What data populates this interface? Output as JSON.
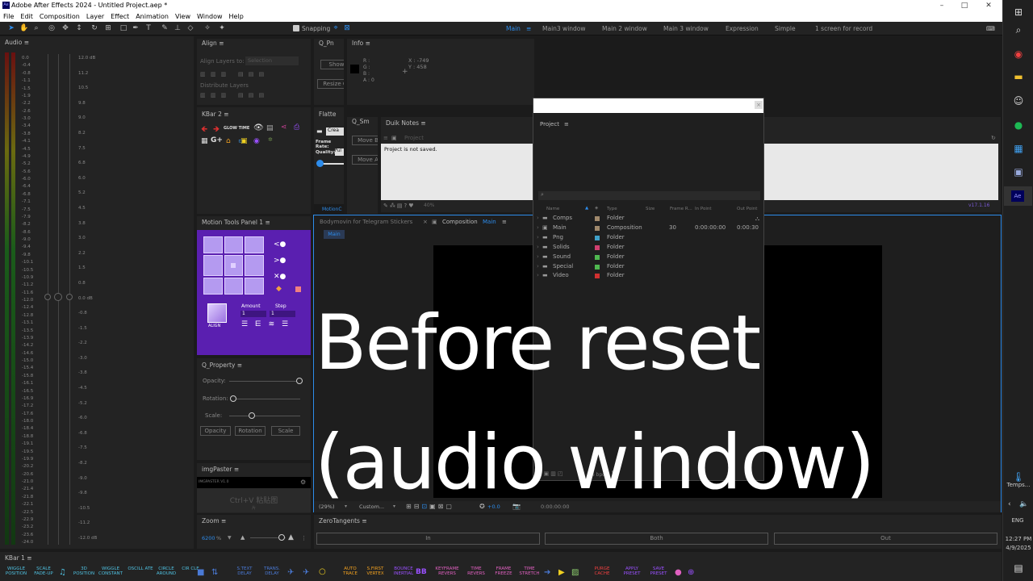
{
  "window": {
    "title": "Adobe After Effects 2024 - Untitled Project.aep *",
    "logo": "Ae",
    "controls": [
      "–",
      "□",
      "✕"
    ]
  },
  "menu": [
    "File",
    "Edit",
    "Composition",
    "Layer",
    "Effect",
    "Animation",
    "View",
    "Window",
    "Help"
  ],
  "toolbar": {
    "snapping_label": "Snapping",
    "workspaces": [
      "Main",
      "Main3 window",
      "Main 2 window",
      "Main 3 window",
      "Expression",
      "Simple",
      "1 screen for record"
    ]
  },
  "audio": {
    "title": "Audio",
    "left_scale": [
      "0.0",
      "-0.4",
      "-0.8",
      "-1.1",
      "-1.5",
      "-1.9",
      "-2.2",
      "-2.6",
      "-3.0",
      "-3.4",
      "-3.8",
      "-4.1",
      "-4.5",
      "-4.9",
      "-5.2",
      "-5.6",
      "-6.0",
      "-6.4",
      "-6.8",
      "-7.1",
      "-7.5",
      "-7.9",
      "-8.2",
      "-8.6",
      "-9.0",
      "-9.4",
      "-9.8",
      "-10.1",
      "-10.5",
      "-10.9",
      "-11.2",
      "-11.6",
      "-12.0",
      "-12.4",
      "-12.8",
      "-13.1",
      "-13.5",
      "-13.9",
      "-14.2",
      "-14.6",
      "-15.0",
      "-15.4",
      "-15.8",
      "-16.1",
      "-16.5",
      "-16.9",
      "-17.2",
      "-17.6",
      "-18.0",
      "-18.4",
      "-18.8",
      "-19.1",
      "-19.5",
      "-19.9",
      "-20.2",
      "-20.6",
      "-21.0",
      "-21.4",
      "-21.8",
      "-22.1",
      "-22.5",
      "-22.9",
      "-23.2",
      "-23.6",
      "-24.0"
    ],
    "right_scale": [
      "12.0 dB",
      "11.2",
      "10.5",
      "9.8",
      "9.0",
      "8.2",
      "7.5",
      "6.8",
      "6.0",
      "5.2",
      "4.5",
      "3.8",
      "3.0",
      "2.2",
      "1.5",
      "0.8",
      "0.0 dB",
      "-0.8",
      "-1.5",
      "-2.2",
      "-3.0",
      "-3.8",
      "-4.5",
      "-5.2",
      "-6.0",
      "-6.8",
      "-7.5",
      "-8.2",
      "-9.0",
      "-9.8",
      "-10.5",
      "-11.2",
      "-12.0 dB"
    ]
  },
  "align": {
    "title": "Align",
    "align_to_label": "Align Layers to:",
    "align_to_value": "Selection",
    "distribute_label": "Distribute Layers"
  },
  "q_pn": {
    "title": "Q_Pn",
    "show": "Show",
    "resize": "Resize C"
  },
  "info": {
    "title": "Info",
    "r": "R :",
    "g": "G :",
    "b": "B :",
    "a": "A : 0",
    "x": "X : -749",
    "y": "Y : 458"
  },
  "kbar2": {
    "title": "KBar 2",
    "glow": "GLOW TIME"
  },
  "flatte": {
    "title": "Flatte",
    "create": "Crea",
    "frame_rate": "Frame Rate:",
    "quality": "Quality:",
    "quality_val": "Ful",
    "footer": "MotionC"
  },
  "q_sm": {
    "title": "Q_Sm",
    "move_b": "Move B",
    "move_a": "Move A"
  },
  "duik": {
    "title": "Duik Notes",
    "project_label": "Project",
    "note": "Project is not saved.",
    "zoom": "40%",
    "version": "v17.1.16"
  },
  "project": {
    "title": "Project",
    "columns": {
      "name": "Name",
      "type": "Type",
      "size": "Size",
      "frame": "Frame R...",
      "in": "In Point",
      "out": "Out Point"
    },
    "rows": [
      {
        "name": "Comps",
        "type": "Folder",
        "color": "#a0896c",
        "fr": "",
        "in": "",
        "out": ""
      },
      {
        "name": "Main",
        "type": "Composition",
        "color": "#a0896c",
        "fr": "30",
        "in": "0:00:00:00",
        "out": "0:00:30"
      },
      {
        "name": "Png",
        "type": "Folder",
        "color": "#3fa0c8",
        "fr": "",
        "in": "",
        "out": ""
      },
      {
        "name": "Solids",
        "type": "Folder",
        "color": "#d04070",
        "fr": "",
        "in": "",
        "out": ""
      },
      {
        "name": "Sound",
        "type": "Folder",
        "color": "#4fb850",
        "fr": "",
        "in": "",
        "out": ""
      },
      {
        "name": "Special",
        "type": "Folder",
        "color": "#4fb850",
        "fr": "",
        "in": "",
        "out": ""
      },
      {
        "name": "Video",
        "type": "Folder",
        "color": "#d03030",
        "fr": "",
        "in": "",
        "out": ""
      }
    ],
    "bpc": "16 bpc"
  },
  "motion_tools": {
    "title": "Motion Tools Panel 1",
    "amount_label": "Amount",
    "step_label": "Step",
    "amount": "1",
    "step": "1",
    "align": "ALIGN"
  },
  "q_property": {
    "title": "Q_Property",
    "opacity": "Opacity:",
    "rotation": "Rotation:",
    "scale": "Scale:",
    "buttons": [
      "Opacity",
      "Rotation",
      "Scale"
    ]
  },
  "imgpaster": {
    "title": "imgPaster",
    "version": "IMGPASTER V1.0",
    "hint": "Ctrl+V 粘贴图",
    "hint2": "片"
  },
  "zoom": {
    "title": "Zoom",
    "value": "6200",
    "unit": "%"
  },
  "comp": {
    "tab_other": "Bodymovin for Telegram Stickers",
    "tab_label": "Composition",
    "tab_name": "Main",
    "crumb": "Main",
    "zoom_level": "(29%)",
    "res": "Custom...",
    "exposure": "+0.0",
    "timecode": "0:00:00:00"
  },
  "zero_tangents": {
    "title": "ZeroTangents",
    "in": "In",
    "both": "Both",
    "out": "Out"
  },
  "kbar1": {
    "title": "KBar 1",
    "items": [
      "WIGGLE POSITION",
      "SCALE FADE-UP",
      "3D POSITION",
      "WIGGLE CONSTANT",
      "OSCILL ATE",
      "CIRCLE AROUND",
      "CIR CLE",
      "S.TEXT DELAY",
      "TRANS. DELAY",
      "AUTO TRACE",
      "S.FIRST VERTEX",
      "BOUNCE INERTIAL",
      "KEYFRAME REVERS",
      "TIME REVERS",
      "FRAME FREEZE",
      "TIME STRETCH",
      "PURGE CACHE",
      "APPLY PRESET",
      "SAVE PRESET"
    ]
  },
  "overlay": {
    "line1": "Before reset",
    "line2": "(audio window)"
  },
  "os": {
    "temps": "Temps...",
    "lang": "ENG",
    "time": "12:27 PM",
    "date": "4/9/2025"
  },
  "colors": {
    "accent": "#2d8ceb",
    "bg": "#1b1b1b",
    "panel": "#232323",
    "motion_purple": "#7b33d6"
  }
}
